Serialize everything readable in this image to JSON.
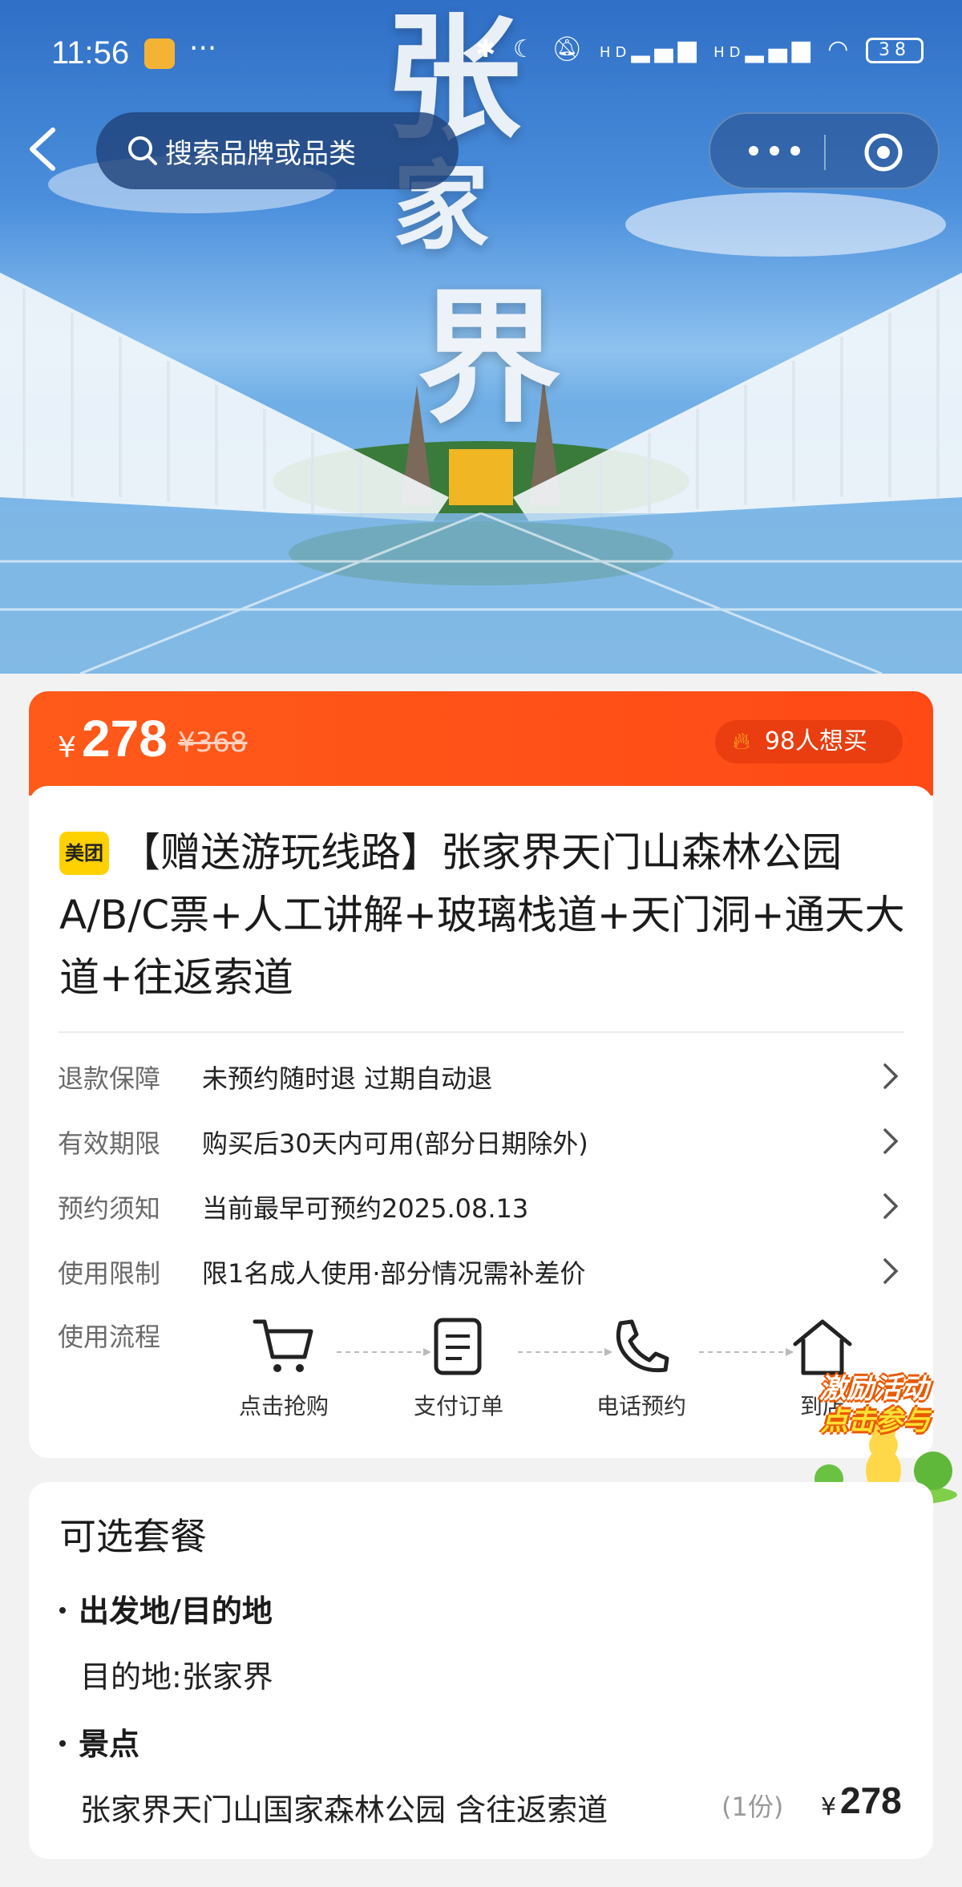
{
  "status_bar": {
    "time": "11:56",
    "more": "···",
    "battery": "38",
    "signal_1": "HD",
    "signal_2": "HD"
  },
  "hero": {
    "calligraphy_top": "张",
    "calligraphy_mid": "家",
    "calligraphy_bottom": "界"
  },
  "nav": {
    "search_placeholder": "搜索品牌或品类"
  },
  "price": {
    "currency": "¥",
    "current": "278",
    "original": "¥368",
    "want_count_label": "98人想买"
  },
  "product": {
    "brand_badge": "美团",
    "title": "【赠送游玩线路】张家界天门山森林公园A/B/C票+人工讲解+玻璃栈道+天门洞+通天大道+往返索道"
  },
  "info_rows": [
    {
      "key": "退款保障",
      "value": "未预约随时退 过期自动退"
    },
    {
      "key": "有效期限",
      "value": "购买后30天内可用(部分日期除外)"
    },
    {
      "key": "预约须知",
      "value": "当前最早可预约2025.08.13"
    },
    {
      "key": "使用限制",
      "value": "限1名成人使用·部分情况需补差价"
    }
  ],
  "flow": {
    "key": "使用流程",
    "steps": [
      "点击抢购",
      "支付订单",
      "电话预约",
      "到店"
    ]
  },
  "promo": {
    "line1": "激励活动",
    "line2": "点击参与"
  },
  "package": {
    "title": "可选套餐",
    "section_origin": "出发地/目的地",
    "destination": "目的地:张家界",
    "section_spot": "景点",
    "spot_name": "张家界天门山国家森林公园 含往返索道",
    "qty": "(1份)",
    "currency": "¥",
    "price": "278"
  },
  "colors": {
    "accent": "#ff5a1a",
    "want_pill": "#ea3d10",
    "brand_yellow": "#ffd100"
  }
}
